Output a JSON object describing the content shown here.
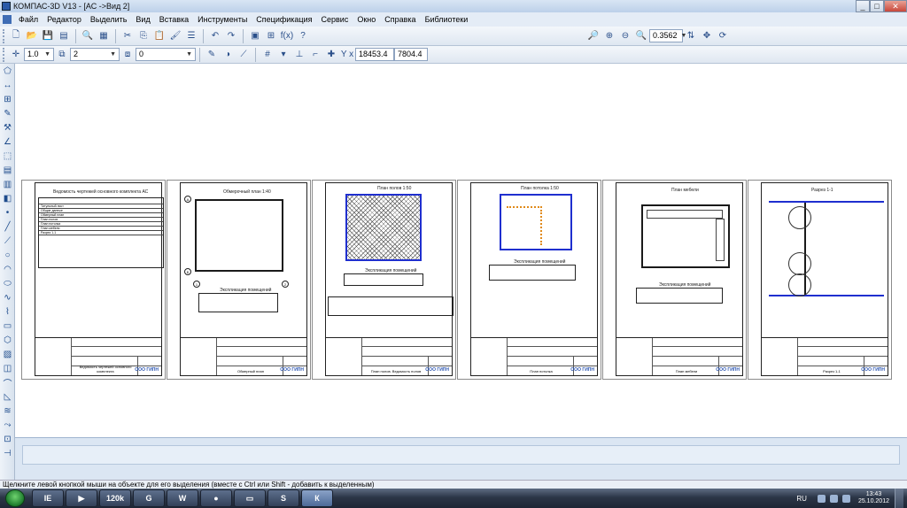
{
  "window": {
    "title": "КОМПАС-3D V13 - [АС ->Вид 2]",
    "buttons": [
      "_",
      "□",
      "✕"
    ]
  },
  "menu": {
    "items": [
      "Файл",
      "Редактор",
      "Выделить",
      "Вид",
      "Вставка",
      "Инструменты",
      "Спецификация",
      "Сервис",
      "Окно",
      "Справка",
      "Библиотеки"
    ]
  },
  "toolbar": {
    "zoom_value": "0.3562"
  },
  "props": {
    "line_width": "1.0",
    "layer": "2",
    "style": "0",
    "coord_x": "18453.4",
    "coord_y": "7804.4"
  },
  "sheets": [
    {
      "heading": "Ведомость чертежей основного комплекта АС",
      "sheet_name": "Ведомость чертежей основного комплекта",
      "rows": [
        "Титульный лист",
        "Общие данные",
        "Обмерный план",
        "План полов",
        "План потолка",
        "План мебели",
        "Разрез 1-1"
      ]
    },
    {
      "heading": "Обмерочный план 1:40",
      "sheet_name": "Обмерный план",
      "legend": "Экспликация помещений"
    },
    {
      "heading": "План полов 1:50",
      "sheet_name": "План полов. Ведомость полов",
      "legend": "Экспликация помещений"
    },
    {
      "heading": "План потолка 1:50",
      "sheet_name": "План потолка",
      "legend": "Экспликация помещений"
    },
    {
      "heading": "План мебели",
      "sheet_name": "План мебели",
      "legend": "Экспликация помещений"
    },
    {
      "heading": "Разрез 1-1",
      "sheet_name": "Разрез 1-1",
      "legend": ""
    }
  ],
  "company": "ООО ГИПН",
  "status": {
    "message": "Щелкните левой кнопкой мыши на объекте для его выделения (вместе с Ctrl или Shift - добавить к выделенным)"
  },
  "taskbar": {
    "apps": [
      "IE",
      "▶",
      "120k",
      "G",
      "W",
      "●",
      "▭",
      "S",
      "К"
    ],
    "language": "RU",
    "time": "13:43",
    "date": "25.10.2012"
  }
}
